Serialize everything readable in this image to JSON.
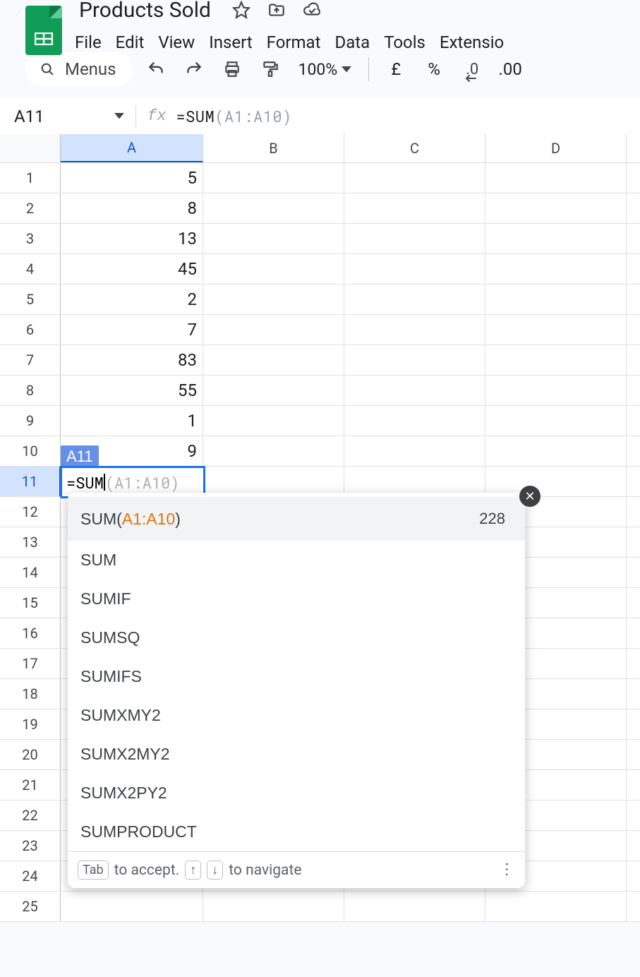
{
  "doc": {
    "title": "Products Sold"
  },
  "menu": {
    "file": "File",
    "edit": "Edit",
    "view": "View",
    "insert": "Insert",
    "format": "Format",
    "data": "Data",
    "tools": "Tools",
    "extensions": "Extensio"
  },
  "toolbar": {
    "menus": "Menus",
    "zoom": "100%",
    "currency": "£",
    "percent": "%",
    "dec_dec": ".0",
    "inc_dec": ".00"
  },
  "namebox": {
    "ref": "A11",
    "formula_pre": "=SUM",
    "formula_ghost": "(A1:A10)"
  },
  "columns": [
    "A",
    "B",
    "C",
    "D"
  ],
  "rows": [
    {
      "n": "1",
      "a": "5"
    },
    {
      "n": "2",
      "a": "8"
    },
    {
      "n": "3",
      "a": "13"
    },
    {
      "n": "4",
      "a": "45"
    },
    {
      "n": "5",
      "a": "2"
    },
    {
      "n": "6",
      "a": "7"
    },
    {
      "n": "7",
      "a": "83"
    },
    {
      "n": "8",
      "a": "55"
    },
    {
      "n": "9",
      "a": "1"
    },
    {
      "n": "10",
      "a": "9"
    },
    {
      "n": "11",
      "a": ""
    },
    {
      "n": "12",
      "a": ""
    },
    {
      "n": "13",
      "a": ""
    },
    {
      "n": "14",
      "a": ""
    },
    {
      "n": "15",
      "a": ""
    },
    {
      "n": "16",
      "a": ""
    },
    {
      "n": "17",
      "a": ""
    },
    {
      "n": "18",
      "a": ""
    },
    {
      "n": "19",
      "a": ""
    },
    {
      "n": "20",
      "a": ""
    },
    {
      "n": "21",
      "a": ""
    },
    {
      "n": "22",
      "a": ""
    },
    {
      "n": "23",
      "a": ""
    },
    {
      "n": "24",
      "a": ""
    },
    {
      "n": "25",
      "a": ""
    }
  ],
  "active": {
    "tag": "A11",
    "typed": "=SUM",
    "ghost": "(A1:A10)"
  },
  "autocomplete": {
    "first_pre": "SUM(",
    "first_range": "A1:A10",
    "first_post": ")",
    "result": "228",
    "items": [
      "SUM",
      "SUMIF",
      "SUMSQ",
      "SUMIFS",
      "SUMXMY2",
      "SUMX2MY2",
      "SUMX2PY2",
      "SUMPRODUCT"
    ],
    "footer_tab": "Tab",
    "footer_accept": "to accept.",
    "footer_up": "↑",
    "footer_down": "↓",
    "footer_nav": "to navigate"
  }
}
